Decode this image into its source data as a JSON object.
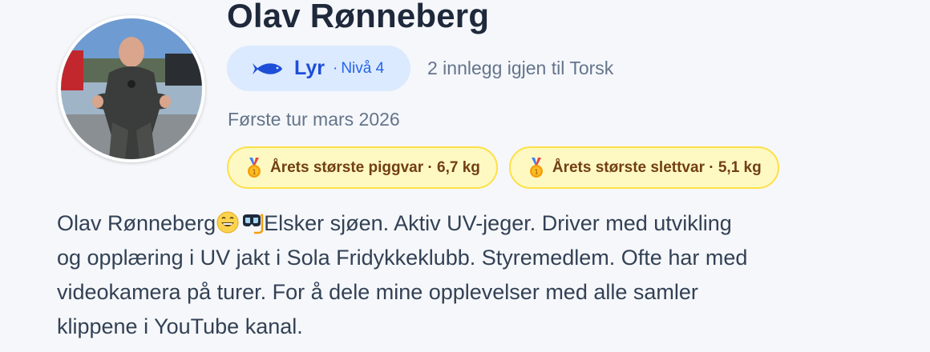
{
  "profile": {
    "name": "Olav Rønneberg",
    "avatar_alt": "profile-photo",
    "level": {
      "icon": "fish-icon",
      "name": "Lyr",
      "separator": "·",
      "number_label": "Nivå 4"
    },
    "next_level_text": "2 innlegg igjen til Torsk",
    "first_trip": "Første tur mars 2026",
    "badges": [
      {
        "icon": "gold-medal-icon",
        "text": "Årets største piggvar · 6,7 kg"
      },
      {
        "icon": "gold-medal-icon",
        "text": "Årets største slettvar · 5,1 kg"
      }
    ],
    "bio": {
      "line1_a": "Olav Rønneberg",
      "line1_emoji1": "grinning-face-emoji",
      "line1_emoji2": "diving-mask-emoji",
      "line1_b": "Elsker sjøen. Aktiv UV-jeger. Driver med utvikling",
      "line2": "og opplæring i UV jakt i Sola Fridykkeklubb. Styremedlem. Ofte har med",
      "line3": "videokamera på turer. For å dele mine opplevelser med alle samler",
      "line4": "klippene i YouTube kanal."
    }
  },
  "colors": {
    "background": "#f5f7fa",
    "level_pill_bg": "#dbeafe",
    "level_text": "#1d4ed8",
    "badge_bg": "#fef9c3",
    "badge_border": "#fde047",
    "badge_text": "#713f12",
    "muted_text": "#64748b"
  }
}
